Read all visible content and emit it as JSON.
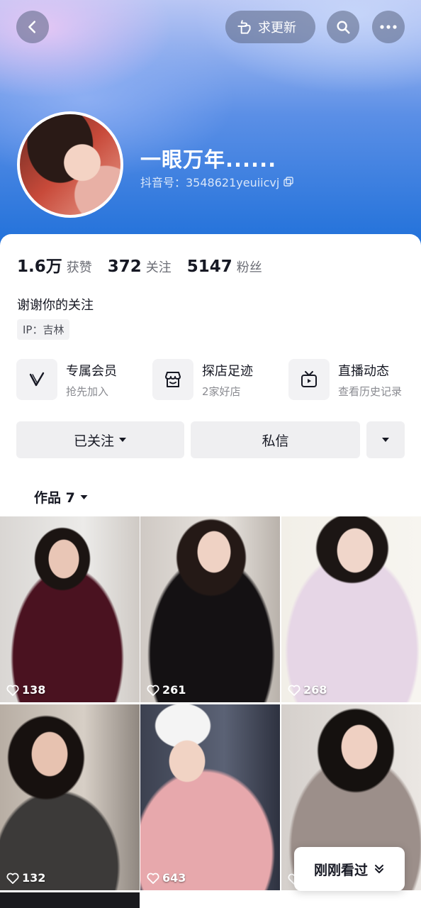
{
  "header": {
    "request_update_label": "求更新",
    "nickname": "一眼万年......",
    "douyin_id": "抖音号：3548621yeuiicvj"
  },
  "stats": [
    {
      "value": "1.6万",
      "label": "获赞"
    },
    {
      "value": "372",
      "label": "关注"
    },
    {
      "value": "5147",
      "label": "粉丝"
    }
  ],
  "bio": "谢谢你的关注",
  "ip": "IP：吉林",
  "features": [
    {
      "title": "专属会员",
      "sub": "抢先加入",
      "icon": "v-badge-icon"
    },
    {
      "title": "探店足迹",
      "sub": "2家好店",
      "icon": "shop-icon"
    },
    {
      "title": "直播动态",
      "sub": "查看历史记录",
      "icon": "tv-icon"
    }
  ],
  "actions": {
    "follow_label": "已关注",
    "message_label": "私信"
  },
  "works_tab": "作品 7",
  "videos": [
    {
      "likes": "138"
    },
    {
      "likes": "261"
    },
    {
      "likes": "268"
    },
    {
      "likes": "132"
    },
    {
      "likes": "643"
    },
    {
      "likes": ""
    }
  ],
  "recent_label": "刚刚看过"
}
